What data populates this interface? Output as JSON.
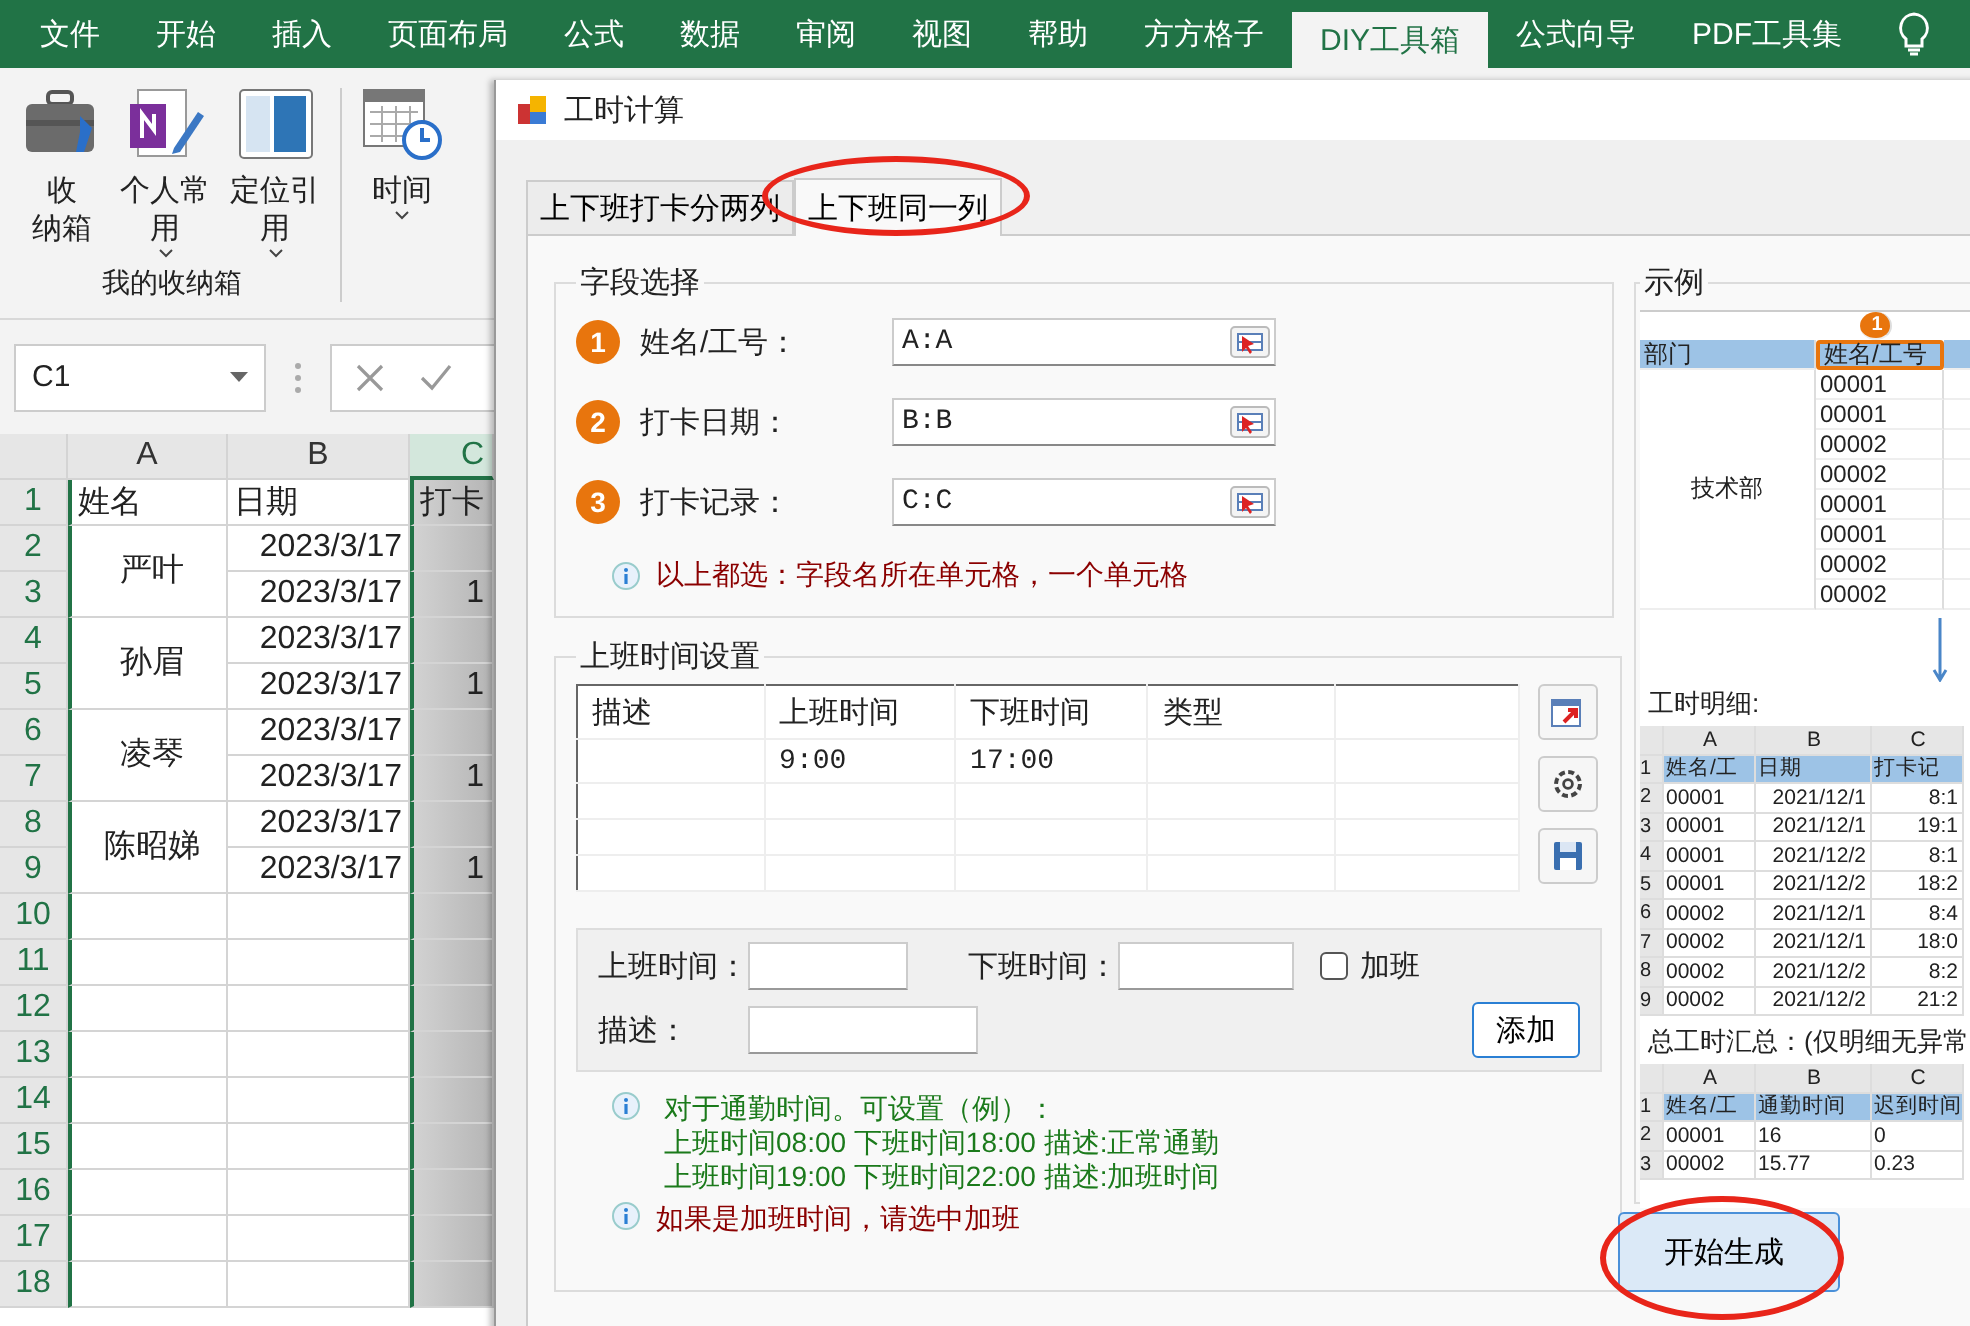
{
  "ribbon": {
    "tabs": [
      {
        "label": "文件",
        "selected": false
      },
      {
        "label": "开始",
        "selected": false
      },
      {
        "label": "插入",
        "selected": false
      },
      {
        "label": "页面布局",
        "selected": false
      },
      {
        "label": "公式",
        "selected": false
      },
      {
        "label": "数据",
        "selected": false
      },
      {
        "label": "审阅",
        "selected": false
      },
      {
        "label": "视图",
        "selected": false
      },
      {
        "label": "帮助",
        "selected": false
      },
      {
        "label": "方方格子",
        "selected": false
      },
      {
        "label": "DIY工具箱",
        "selected": true
      },
      {
        "label": "公式向导",
        "selected": false
      },
      {
        "label": "PDF工具集",
        "selected": false
      }
    ],
    "buttons": [
      {
        "lines": [
          "收",
          "纳箱"
        ],
        "dropdown": false
      },
      {
        "lines": [
          "个人常",
          "用"
        ],
        "dropdown": true
      },
      {
        "lines": [
          "定位引",
          "用"
        ],
        "dropdown": true
      }
    ],
    "group_label": "我的收纳箱",
    "extra_buttons": [
      {
        "lines": [
          "时间"
        ],
        "dropdown": true
      }
    ]
  },
  "name_box": {
    "value": "C1"
  },
  "sheet": {
    "columns": [
      {
        "label": "A",
        "selected": false
      },
      {
        "label": "B",
        "selected": false
      },
      {
        "label": "C",
        "selected": true
      }
    ],
    "row_numbers": [
      "1",
      "2",
      "3",
      "4",
      "5",
      "6",
      "7",
      "8",
      "9",
      "10",
      "11",
      "12",
      "13",
      "14",
      "15",
      "16",
      "17",
      "18"
    ],
    "header": [
      "姓名",
      "日期",
      "打卡"
    ],
    "records": [
      {
        "name": "严叶",
        "dates": [
          "2023/3/17",
          "2023/3/17"
        ],
        "second_punch": "1"
      },
      {
        "name": "孙眉",
        "dates": [
          "2023/3/17",
          "2023/3/17"
        ],
        "second_punch": "1"
      },
      {
        "name": "凌琴",
        "dates": [
          "2023/3/17",
          "2023/3/17"
        ],
        "second_punch": "1"
      },
      {
        "name": "陈昭娣",
        "dates": [
          "2023/3/17",
          "2023/3/17"
        ],
        "second_punch": "1"
      }
    ]
  },
  "dialog": {
    "title": "工时计算",
    "tabs": [
      {
        "label": "上下班打卡分两列",
        "selected": false
      },
      {
        "label": "上下班同一列",
        "selected": true
      }
    ],
    "field_group": {
      "title": "字段选择",
      "fields": [
        {
          "number": "1",
          "label": "姓名/工号：",
          "value": "A:A"
        },
        {
          "number": "2",
          "label": "打卡日期：",
          "value": "B:B"
        },
        {
          "number": "3",
          "label": "打卡记录：",
          "value": "C:C"
        }
      ],
      "note": "以上都选：字段名所在单元格，一个单元格"
    },
    "schedule_group": {
      "title": "上班时间设置",
      "columns": [
        "描述",
        "上班时间",
        "下班时间",
        "类型"
      ],
      "rows": [
        {
          "start_time": "9:00",
          "end_time": "17:00"
        }
      ],
      "form": {
        "start_label": "上班时间：",
        "end_label": "下班时间：",
        "overtime": {
          "label": "加班",
          "checked": false
        },
        "description_label": "描述：",
        "add_button": "添加"
      },
      "intro": "对于通勤时间。可设置（例）：",
      "examples": [
        "上班时间08:00 下班时间18:00 描述:正常通勤",
        "上班时间19:00 下班时间22:00 描述:加班时间"
      ],
      "overtime_note": "如果是加班时间，请选中加班"
    },
    "example": {
      "title": "示例",
      "source": {
        "headers": [
          "部门",
          "姓名/工号"
        ],
        "marker": "1",
        "department": "技术部",
        "ids": [
          "00001",
          "00001",
          "00002",
          "00002",
          "00001",
          "00001",
          "00002",
          "00002"
        ]
      },
      "detail": {
        "caption": "工时明细:",
        "columns": [
          "A",
          "B",
          "C"
        ],
        "row_numbers": [
          "1",
          "2",
          "3",
          "4",
          "5",
          "6",
          "7",
          "8",
          "9"
        ],
        "header": [
          "姓名/工",
          "日期",
          "打卡记"
        ],
        "rows": [
          [
            "00001",
            "2021/12/1",
            "8:1"
          ],
          [
            "00001",
            "2021/12/1",
            "19:1"
          ],
          [
            "00001",
            "2021/12/2",
            "8:1"
          ],
          [
            "00001",
            "2021/12/2",
            "18:2"
          ],
          [
            "00002",
            "2021/12/1",
            "8:4"
          ],
          [
            "00002",
            "2021/12/1",
            "18:0"
          ],
          [
            "00002",
            "2021/12/2",
            "8:2"
          ],
          [
            "00002",
            "2021/12/2",
            "21:2"
          ]
        ]
      },
      "summary": {
        "caption": "总工时汇总：(仅明细无异常",
        "columns": [
          "A",
          "B",
          "C"
        ],
        "row_numbers": [
          "1",
          "2",
          "3"
        ],
        "header": [
          "姓名/工",
          "通勤时间",
          "迟到时间"
        ],
        "rows": [
          [
            "00001",
            "16",
            "0"
          ],
          [
            "00002",
            "15.77",
            "0.23"
          ]
        ]
      }
    },
    "generate_button": "开始生成"
  }
}
